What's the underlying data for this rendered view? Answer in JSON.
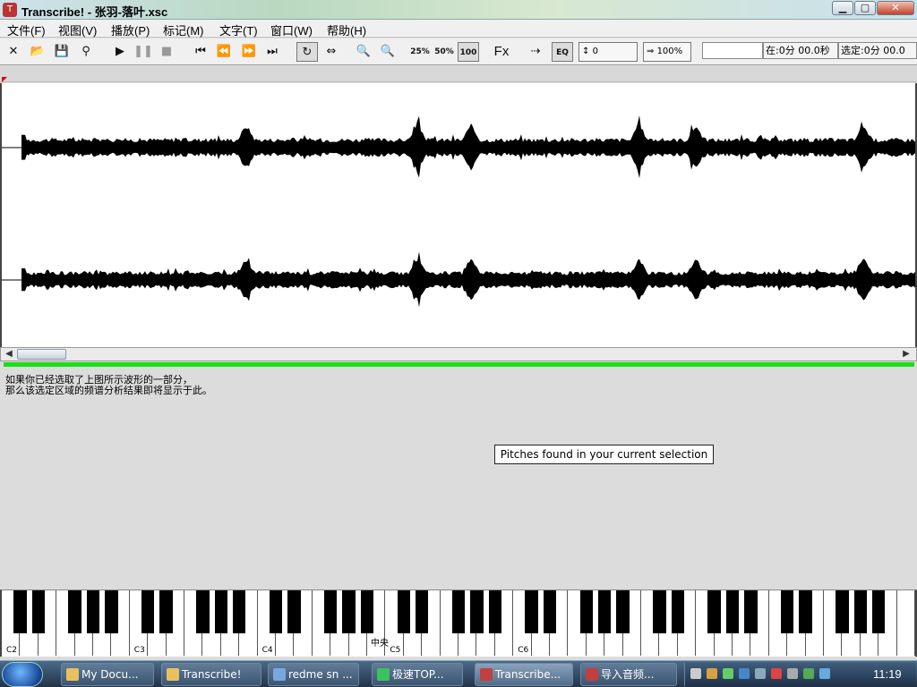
{
  "window": {
    "title": "Transcribe! - 张羽-落叶.xsc",
    "controls": {
      "minimize": "▁",
      "maximize": "▢",
      "close": "✕"
    }
  },
  "menu": [
    "文件(F)",
    "视图(V)",
    "播放(P)",
    "标记(M)",
    "文字(T)",
    "窗口(W)",
    "帮助(H)"
  ],
  "toolbar": {
    "speed_25": "25%",
    "speed_50": "50%",
    "speed_100": "100",
    "fx": "Fx",
    "fx_eq": "EQ",
    "pitch_value": "0",
    "speed_value": "100%",
    "position_label": "在:0分 00.0秒",
    "selection_label": "选定:0分 00.0"
  },
  "analysis": {
    "hint_line1": "如果你已经选取了上图所示波形的一部分，",
    "hint_line2": "那么该选定区域的频谱分析结果即将显示于此。",
    "pitches_label": "Pitches found in your current selection"
  },
  "piano": {
    "labels": [
      "C2",
      "C3",
      "C4",
      "C5",
      "C6"
    ],
    "middle_c": "中央"
  },
  "taskbar": {
    "items": [
      {
        "label": "My Docu...",
        "icon_color": "#e8c060"
      },
      {
        "label": "Transcribe!",
        "icon_color": "#e8c060"
      },
      {
        "label": "redme sn ...",
        "icon_color": "#7aa6e0"
      },
      {
        "label": "极速TOP...",
        "icon_color": "#3cc060"
      },
      {
        "label": "Transcribe...",
        "icon_color": "#c04040"
      },
      {
        "label": "导入音频...",
        "icon_color": "#c04040"
      }
    ],
    "clock": "11:19"
  }
}
